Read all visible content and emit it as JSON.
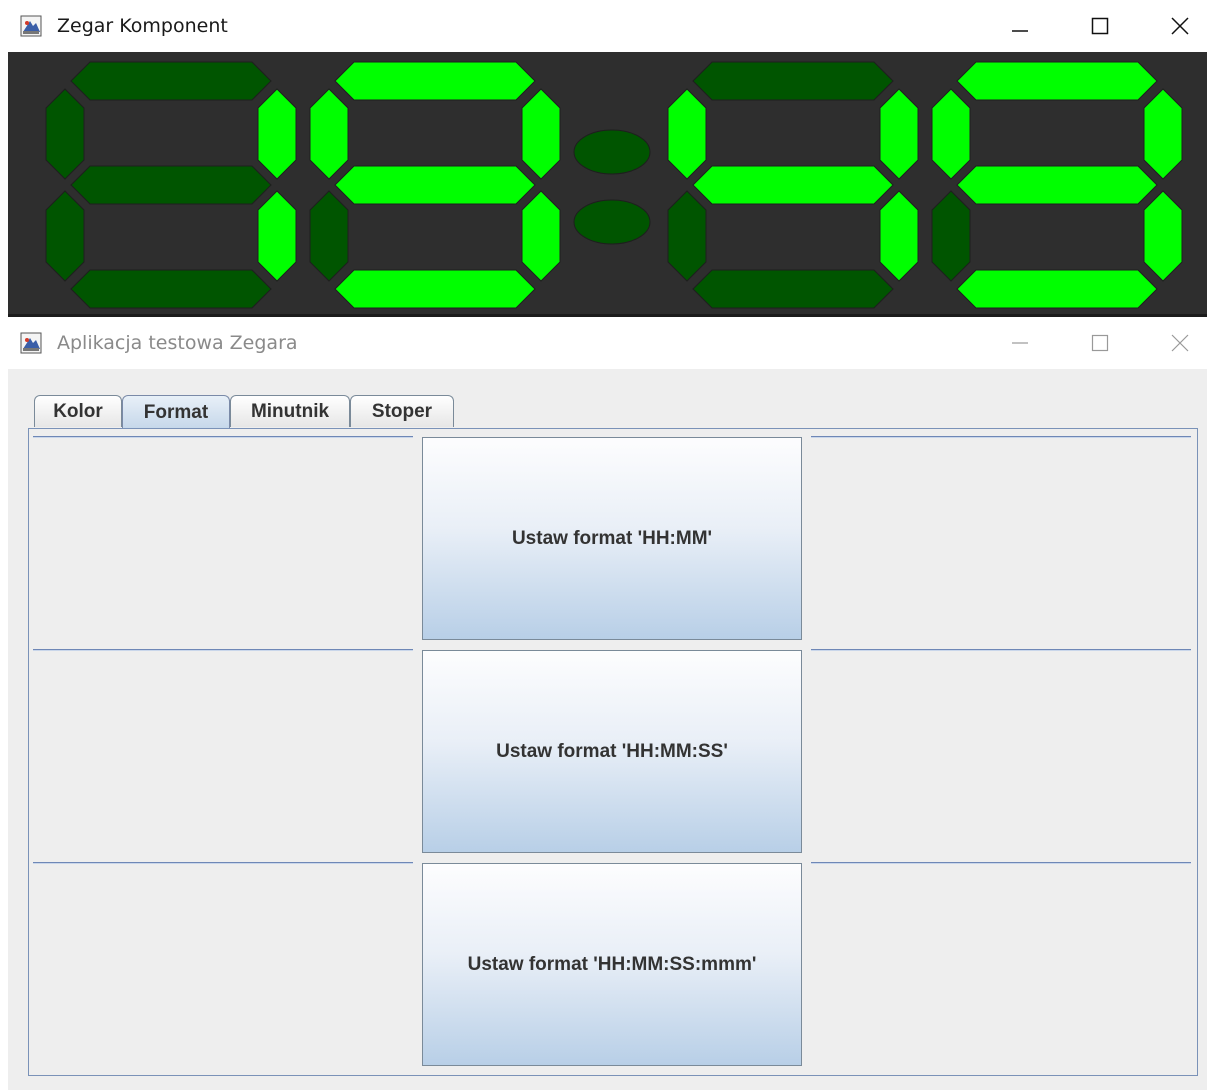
{
  "clock_window": {
    "title": "Zegar Komponent",
    "display": {
      "digit_colors": {
        "on": "#00ff00",
        "off": "#005500",
        "colon_off": "#005500",
        "background": "#2e2e2e"
      },
      "digit_segments": [
        {
          "a": false,
          "b": true,
          "c": true,
          "d": false,
          "e": false,
          "f": false,
          "g": false
        },
        {
          "a": true,
          "b": true,
          "c": true,
          "d": true,
          "e": false,
          "f": true,
          "g": true
        },
        {
          "a": false,
          "b": true,
          "c": true,
          "d": false,
          "e": false,
          "f": true,
          "g": true
        },
        {
          "a": true,
          "b": true,
          "c": true,
          "d": true,
          "e": false,
          "f": true,
          "g": true
        }
      ],
      "colon_lit": false
    }
  },
  "test_window": {
    "title": "Aplikacja testowa Zegara",
    "tabs": [
      {
        "label": "Kolor"
      },
      {
        "label": "Format",
        "selected": true
      },
      {
        "label": "Minutnik"
      },
      {
        "label": "Stoper"
      }
    ],
    "format_buttons": [
      {
        "label": "Ustaw format 'HH:MM'"
      },
      {
        "label": "Ustaw format 'HH:MM:SS'"
      },
      {
        "label": "Ustaw format 'HH:MM:SS:mmm'"
      }
    ]
  },
  "icons": {
    "app_icon": "java-app-icon",
    "minimize": "minimize-icon",
    "maximize": "maximize-icon",
    "close": "close-icon"
  }
}
